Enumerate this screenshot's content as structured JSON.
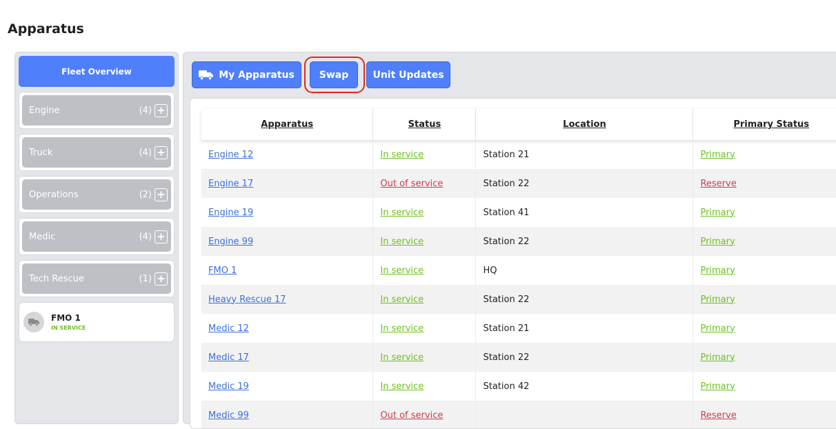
{
  "page": {
    "title": "Apparatus"
  },
  "sidebar": {
    "fleet_overview": "Fleet Overview",
    "categories": [
      {
        "name": "Engine",
        "count": "(4)"
      },
      {
        "name": "Truck",
        "count": "(4)"
      },
      {
        "name": "Operations",
        "count": "(2)"
      },
      {
        "name": "Medic",
        "count": "(4)"
      },
      {
        "name": "Tech Rescue",
        "count": "(1)"
      }
    ],
    "unit": {
      "name": "FMO 1",
      "status": "IN SERVICE"
    }
  },
  "toolbar": {
    "my_apparatus": "My Apparatus",
    "swap": "Swap",
    "unit_updates": "Unit Updates"
  },
  "table": {
    "headers": [
      "Apparatus",
      "Status",
      "Location",
      "Primary Status"
    ],
    "rows": [
      {
        "apparatus": "Engine 12",
        "status": "In service",
        "location": "Station 21",
        "primary": "Primary"
      },
      {
        "apparatus": "Engine 17",
        "status": "Out of service",
        "location": "Station 22",
        "primary": "Reserve"
      },
      {
        "apparatus": "Engine 19",
        "status": "In service",
        "location": "Station 41",
        "primary": "Primary"
      },
      {
        "apparatus": "Engine 99",
        "status": "In service",
        "location": "Station 22",
        "primary": "Primary"
      },
      {
        "apparatus": "FMO 1",
        "status": "In service",
        "location": "HQ",
        "primary": "Primary"
      },
      {
        "apparatus": "Heavy Rescue 17",
        "status": "In service",
        "location": "Station 22",
        "primary": "Primary"
      },
      {
        "apparatus": "Medic 12",
        "status": "In service",
        "location": "Station 21",
        "primary": "Primary"
      },
      {
        "apparatus": "Medic 17",
        "status": "In service",
        "location": "Station 22",
        "primary": "Primary"
      },
      {
        "apparatus": "Medic 19",
        "status": "In service",
        "location": "Station 42",
        "primary": "Primary"
      },
      {
        "apparatus": "Medic 99",
        "status": "Out of service",
        "location": "",
        "primary": "Reserve"
      }
    ]
  },
  "colors": {
    "accent": "#4f7ffb",
    "in_service": "#6cc11e",
    "out_of_service": "#d23a4a",
    "link": "#3a6fe0",
    "highlight_ring": "#e02a1a"
  },
  "icons": {
    "truck": "truck-icon",
    "plus": "plus-icon"
  }
}
